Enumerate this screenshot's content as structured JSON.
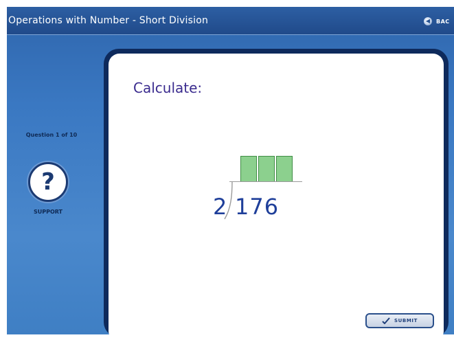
{
  "window": {
    "title": "Operations with Number - Short Division",
    "back_label": "BAC"
  },
  "side": {
    "question_counter": "Question 1 of 10",
    "support_glyph": "?",
    "support_label": "SUPPORT"
  },
  "question": {
    "prompt": "Calculate:",
    "divisor": "2",
    "dividend": "176",
    "answer_boxes": [
      "",
      "",
      ""
    ]
  },
  "footer": {
    "submit_label": "SUBMIT"
  },
  "icons": {
    "back": "back-arrow-icon",
    "support": "question-mark-icon",
    "submit": "check-icon"
  },
  "colors": {
    "background": "#3a78c2",
    "title_bar": "#204a8a",
    "panel_border": "#0e2a5c",
    "answer_box": "#8cd08e",
    "numbers": "#1f3f9a",
    "prompt": "#3a2b8e"
  }
}
